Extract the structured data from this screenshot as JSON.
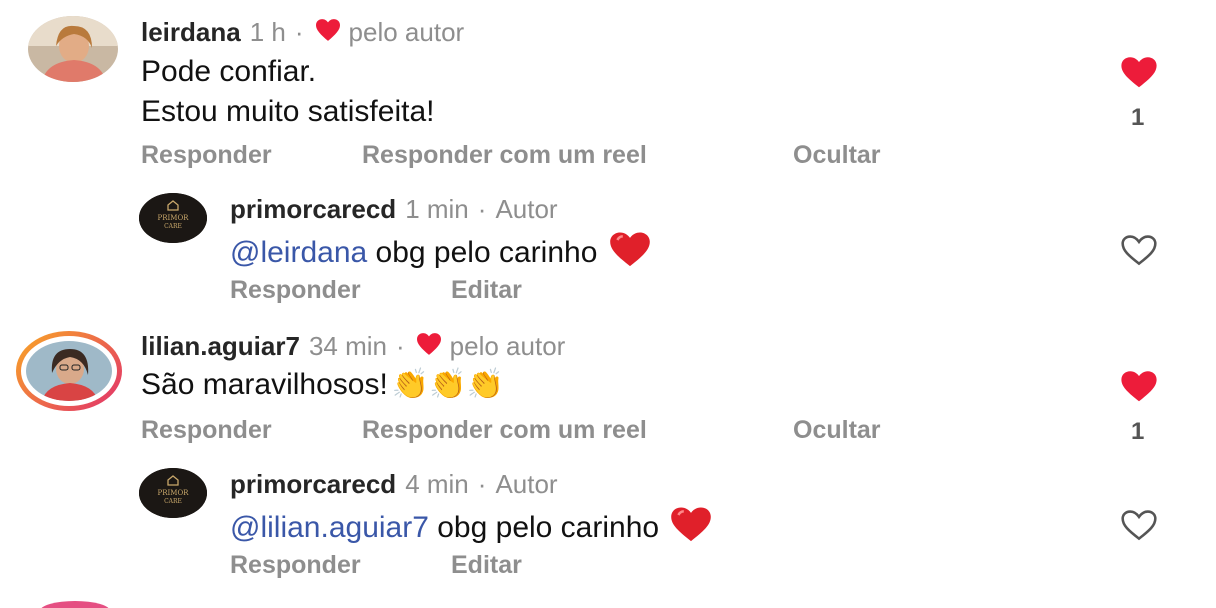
{
  "comments": [
    {
      "username": "leirdana",
      "time": "1 h",
      "separator": "·",
      "liked_by_author_label": "pelo autor",
      "text_lines": [
        "Pode confiar.",
        "Estou muito satisfeita!"
      ],
      "actions": [
        "Responder",
        "Responder com um reel",
        "Ocultar"
      ],
      "like_count": "1",
      "liked": true,
      "reply": {
        "username": "primorcarecd",
        "time": "1 min",
        "separator": "·",
        "badge": "Autor",
        "mention": "@leirdana",
        "text": " obg pelo carinho ",
        "emoji": "❤️",
        "actions": [
          "Responder",
          "Editar"
        ],
        "liked": false,
        "avatar_text": [
          "PRIMOR",
          "CARE"
        ]
      }
    },
    {
      "username": "lilian.aguiar7",
      "time": "34 min",
      "separator": "·",
      "liked_by_author_label": "pelo autor",
      "text": "São maravilhosos!",
      "emoji": "👏👏👏",
      "actions": [
        "Responder",
        "Responder com um reel",
        "Ocultar"
      ],
      "like_count": "1",
      "liked": true,
      "reply": {
        "username": "primorcarecd",
        "time": "4 min",
        "separator": "·",
        "badge": "Autor",
        "mention": "@lilian.aguiar7",
        "text": " obg pelo carinho ",
        "emoji": "❤️",
        "actions": [
          "Responder",
          "Editar"
        ],
        "liked": false,
        "avatar_text": [
          "PRIMOR",
          "CARE"
        ]
      }
    }
  ],
  "colors": {
    "like_red": "#ed1c3a",
    "muted": "#8e8e8e",
    "mention": "#3a57a8",
    "story_ring_start": "#f9a825",
    "story_ring_end": "#e1306c"
  }
}
